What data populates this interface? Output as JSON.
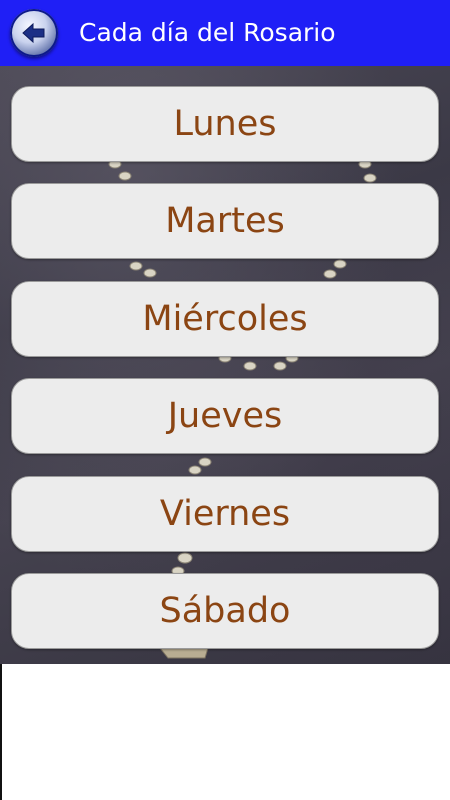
{
  "action_bar": {
    "title": "Cada día del Rosario",
    "background": "#1f1ff6",
    "back_icon": "back-arrow-icon"
  },
  "days": [
    {
      "label": "Lunes"
    },
    {
      "label": "Martes"
    },
    {
      "label": "Miércoles"
    },
    {
      "label": "Jueves"
    },
    {
      "label": "Viernes"
    },
    {
      "label": "Sábado"
    }
  ],
  "colors": {
    "button_text": "#8b4513",
    "button_bg": "#ececec"
  }
}
